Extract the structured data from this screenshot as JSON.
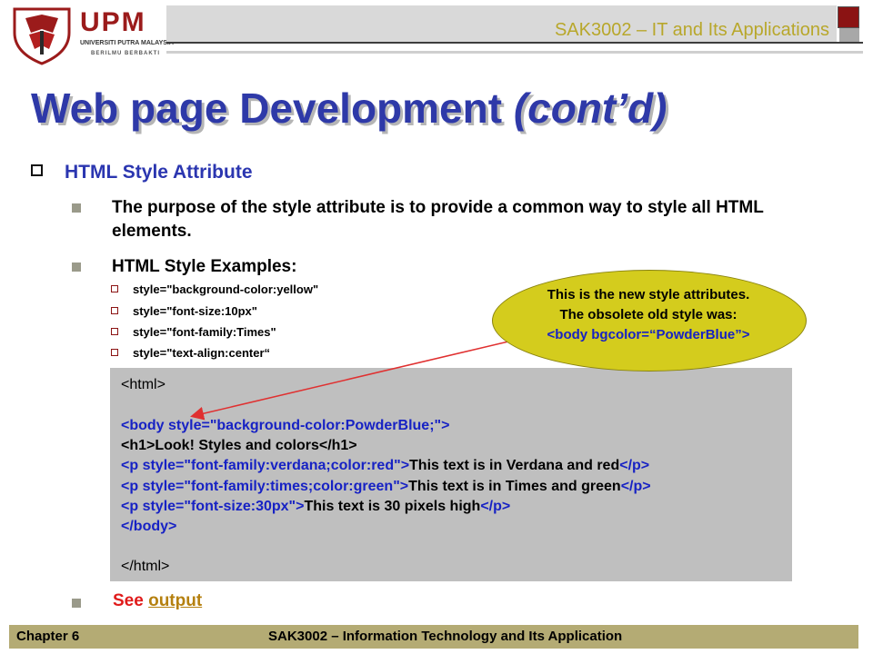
{
  "header": {
    "logo_upm": "UPM",
    "logo_sub": "UNIVERSITI PUTRA MALAYSIA",
    "logo_motto": "BERILMU BERBAKTI",
    "course_title": "SAK3002 – IT and Its Applications"
  },
  "slide": {
    "title_main": "Web page Development",
    "title_italic": "(cont’d)",
    "heading": "HTML Style Attribute",
    "para1": "The purpose of the style attribute is to provide a common way to style all HTML elements.",
    "para2": "HTML Style Examples:",
    "examples": [
      "style=\"background-color:yellow\"",
      "style=\"font-size:10px\"",
      "style=\"font-family:Times\"",
      "style=\"text-align:center“"
    ],
    "see_label": "See",
    "see_link": "output"
  },
  "code": {
    "l1": "<html>",
    "l2_tag": "<body style=\"background-color:PowderBlue;\">",
    "l3a": "<h1>Look! Styles and colors</h1>",
    "l4_open": "<p style=\"font-family:verdana;color:red\">",
    "l4_text": "This text is in Verdana and red",
    "l4_close": "</p>",
    "l5_open": "<p style=\"font-family:times;color:green\">",
    "l5_text": "This text is in Times and green",
    "l5_close": "</p>",
    "l6_open": "<p style=\"font-size:30px\">",
    "l6_text": "This text is 30 pixels high",
    "l6_close": "</p>",
    "l7": "</body>",
    "l8": "</html>"
  },
  "callout": {
    "line1": "This is the new style attributes.",
    "line2": "The obsolete old style  was:",
    "line3": "<body bgcolor=“PowderBlue”>"
  },
  "footer": {
    "chapter": "Chapter 6",
    "course": "SAK3002 – Information Technology and Its Application"
  },
  "colors": {
    "title_blue": "#2e39a8",
    "code_tag_blue": "#1722c4",
    "callout_fill": "#d4cc1d",
    "footer_bg": "#b4ab74",
    "arrow_red": "#e03030"
  }
}
